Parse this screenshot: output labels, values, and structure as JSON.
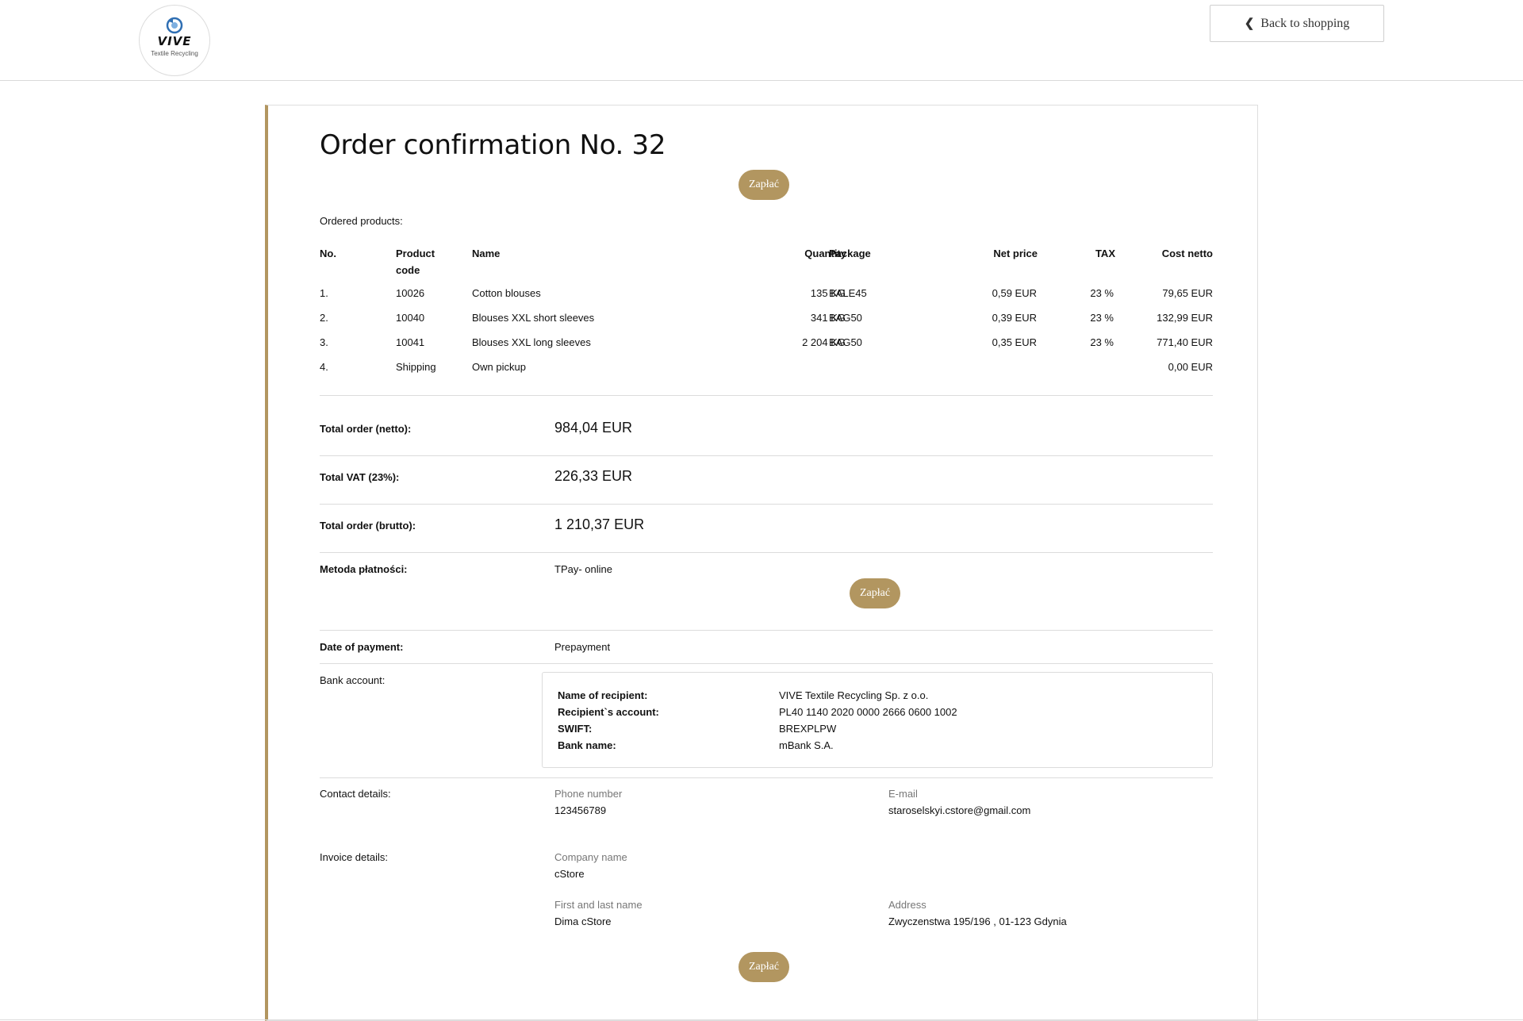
{
  "header": {
    "logo_brand": "VIVE",
    "logo_sub": "Textile Recycling",
    "back_label": "Back to shopping"
  },
  "order": {
    "title": "Order confirmation No. 32",
    "pay_label": "Zapłać",
    "ordered_products_label": "Ordered products:",
    "columns": {
      "no": "No.",
      "code_line1": "Product",
      "code_line2": "code",
      "name": "Name",
      "quantity": "Quantity",
      "package": "Package",
      "net_price": "Net price",
      "tax": "TAX",
      "cost": "Cost netto"
    },
    "rows": [
      {
        "no": "1.",
        "code": "10026",
        "name": "Cotton blouses",
        "quantity": "135 KG",
        "package": "BALE45",
        "net_price": "0,59 EUR",
        "tax": "23 %",
        "cost": "79,65 EUR"
      },
      {
        "no": "2.",
        "code": "10040",
        "name": "Blouses XXL short sleeves",
        "quantity": "341 KG",
        "package": "BAG50",
        "net_price": "0,39 EUR",
        "tax": "23 %",
        "cost": "132,99 EUR"
      },
      {
        "no": "3.",
        "code": "10041",
        "name": "Blouses XXL long sleeves",
        "quantity": "2 204 KG",
        "package": "BAG50",
        "net_price": "0,35 EUR",
        "tax": "23 %",
        "cost": "771,40 EUR"
      },
      {
        "no": "4.",
        "code": "Shipping",
        "name": "Own pickup",
        "quantity": "",
        "package": "",
        "net_price": "",
        "tax": "",
        "cost": "0,00 EUR"
      }
    ],
    "totals": {
      "netto_label": "Total order (netto):",
      "netto_value": "984,04 EUR",
      "vat_label": "Total VAT (23%):",
      "vat_value": "226,33 EUR",
      "brutto_label": "Total order (brutto):",
      "brutto_value": "1 210,37 EUR"
    },
    "payment_method_label": "Metoda płatności:",
    "payment_method_value": "TPay- online",
    "payment_date_label": "Date of payment:",
    "payment_date_value": "Prepayment",
    "bank": {
      "label": "Bank account:",
      "recipient_label": "Name of recipient:",
      "recipient_value": "VIVE Textile Recycling Sp. z o.o.",
      "account_label": "Recipient`s account:",
      "account_value": "PL40 1140 2020 0000 2666 0600 1002",
      "swift_label": "SWIFT:",
      "swift_value": "BREXPLPW",
      "bankname_label": "Bank name:",
      "bankname_value": "mBank S.A."
    },
    "contact": {
      "label": "Contact details:",
      "phone_label": "Phone number",
      "phone_value": "123456789",
      "email_label": "E-mail",
      "email_value": "staroselskyi.cstore@gmail.com"
    },
    "invoice": {
      "label": "Invoice details:",
      "company_label": "Company name",
      "company_value": "cStore",
      "name_label": "First and last name",
      "name_value": "Dima cStore",
      "address_label": "Address",
      "address_value": "Zwyczenstwa 195/196 , 01-123 Gdynia"
    }
  },
  "colors": {
    "accent": "#b29660",
    "border": "#dcdcdc",
    "logo_blue": "#2f6fb3"
  },
  "icons": [
    "recycle-icon",
    "chevron-left-icon"
  ]
}
